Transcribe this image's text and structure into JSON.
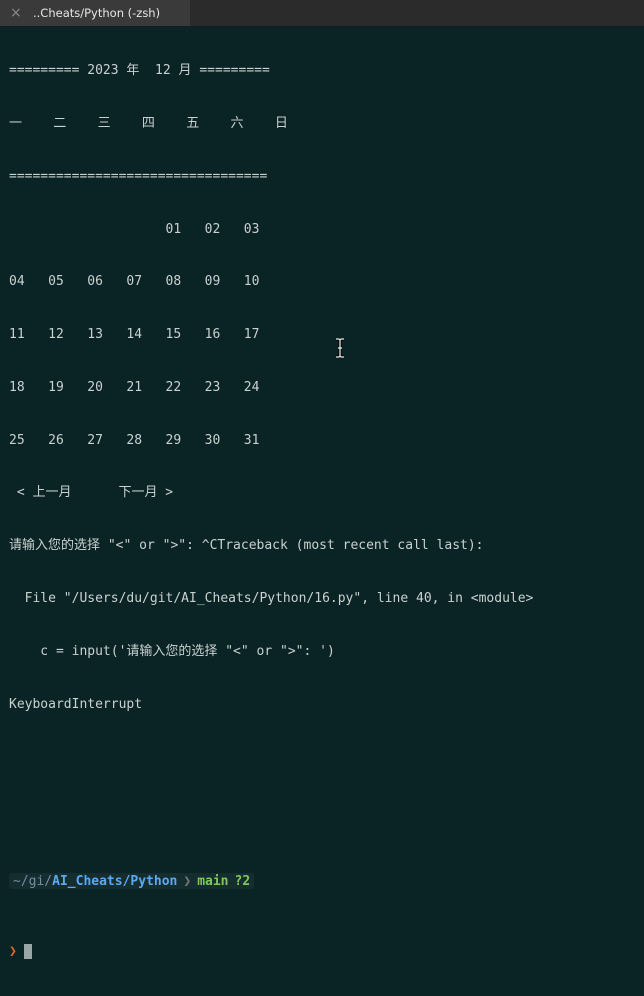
{
  "window": {
    "tab_title": "..Cheats/Python (-zsh)",
    "tab_close_icon": "×"
  },
  "terminal": {
    "lines": [
      "========= 2023 年  12 月 =========",
      "一    二    三    四    五    六    日",
      "=================================",
      "                    01   02   03",
      "04   05   06   07   08   09   10",
      "11   12   13   14   15   16   17",
      "18   19   20   21   22   23   24",
      "25   26   27   28   29   30   31",
      " < 上一月      下一月 >",
      "请输入您的选择 \"<\" or \">\": ^CTraceback (most recent call last):",
      "  File \"/Users/du/git/AI_Cheats/Python/16.py\", line 40, in <module>",
      "    c = input('请输入您的选择 \"<\" or \">\": ')",
      "KeyboardInterrupt",
      "",
      ""
    ],
    "prompt": {
      "path_prefix": "~/gi/",
      "path_current": "AI_Cheats/Python",
      "separator": "❯",
      "git_branch": "main",
      "git_status": "?2",
      "prompt_char": "❯"
    }
  },
  "colors": {
    "background": "#0a2324",
    "text": "#c9d1d1",
    "path": "#5aa9f2",
    "git": "#7ec95a",
    "prompt_char": "#e0662c"
  },
  "icons": {
    "close": "close-icon",
    "mouse_cursor": "text-cursor-icon"
  }
}
